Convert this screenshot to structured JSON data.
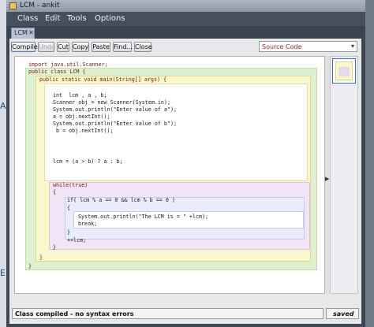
{
  "window": {
    "title": "LCM - ankit",
    "menu": [
      "Class",
      "Edit",
      "Tools",
      "Options"
    ]
  },
  "tab": {
    "label": "LCM",
    "close": "✕"
  },
  "toolbar": {
    "buttons": [
      {
        "label": "Compile",
        "enabled": true
      },
      {
        "label": "Undo",
        "enabled": false
      },
      {
        "label": "Cut",
        "enabled": true
      },
      {
        "label": "Copy",
        "enabled": true
      },
      {
        "label": "Paste",
        "enabled": true
      },
      {
        "label": "Find...",
        "enabled": true
      },
      {
        "label": "Close",
        "enabled": true
      }
    ],
    "view_select": "Source Code"
  },
  "code": {
    "import": "import java.util.Scanner;",
    "class_decl": "public class LCM {",
    "method_decl": "public static void main(String[] args) {",
    "lines_a": [
      "int  lcm , a , b;",
      "Scanner obj = new Scanner(System.in);",
      "System.out.println(\"Enter value of a\");",
      "a = obj.nextInt();",
      "System.out.println(\"Enter value of b\");",
      " b = obj.nextInt();"
    ],
    "ternary": "lcm = (a > b) ? a : b;",
    "while_decl": "while(true)",
    "open_brace": "{",
    "if_decl": "if( lcm % a == 0 && lcm % b == 0 )",
    "if_open": "{",
    "if_body": [
      "System.out.println(\"The LCM is = \" +lcm);",
      "break;"
    ],
    "if_close": "}",
    "increment": "++lcm;",
    "while_close": "}",
    "method_close": "}",
    "class_close": "}"
  },
  "status": {
    "message": "Class compiled - no syntax errors",
    "saved": "saved"
  },
  "colors": {
    "class_scope": "#dff0cf",
    "method_scope": "#fbf7cc",
    "while_scope": "#f2e4f4",
    "if_scope": "#e9edfb"
  }
}
